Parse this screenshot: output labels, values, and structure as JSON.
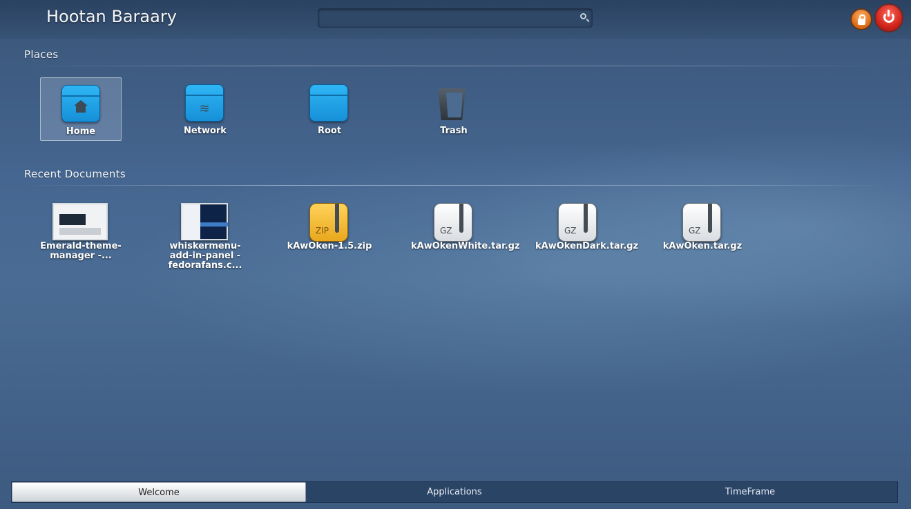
{
  "header": {
    "user_name": "Hootan Baraary",
    "search": {
      "value": "",
      "placeholder": "",
      "icon": "search-icon"
    },
    "lock_icon": "lock-icon",
    "shutdown_icon": "power-icon"
  },
  "places": {
    "title": "Places",
    "items": [
      {
        "label": "Home",
        "icon": "home-folder-icon",
        "selected": true
      },
      {
        "label": "Network",
        "icon": "network-folder-icon",
        "selected": false
      },
      {
        "label": "Root",
        "icon": "folder-icon",
        "selected": false
      },
      {
        "label": "Trash",
        "icon": "trash-icon",
        "selected": false
      }
    ]
  },
  "recent": {
    "title": "Recent Documents",
    "items": [
      {
        "label": "Emerald-theme-manager -...",
        "icon": "image-thumbnail-icon"
      },
      {
        "label": "whiskermenu-add-in-panel - fedorafans.c...",
        "icon": "image-thumbnail-icon"
      },
      {
        "label": "kAwOken-1.5.zip",
        "icon": "zip-archive-icon",
        "badge": "ZIP"
      },
      {
        "label": "kAwOkenWhite.tar.gz",
        "icon": "gz-archive-icon",
        "badge": "GZ"
      },
      {
        "label": "kAwOkenDark.tar.gz",
        "icon": "gz-archive-icon",
        "badge": "GZ"
      },
      {
        "label": "kAwOken.tar.gz",
        "icon": "gz-archive-icon",
        "badge": "GZ"
      }
    ]
  },
  "footer": {
    "tabs": [
      {
        "label": "Welcome",
        "active": true
      },
      {
        "label": "Applications",
        "active": false
      },
      {
        "label": "TimeFrame",
        "active": false
      }
    ]
  }
}
